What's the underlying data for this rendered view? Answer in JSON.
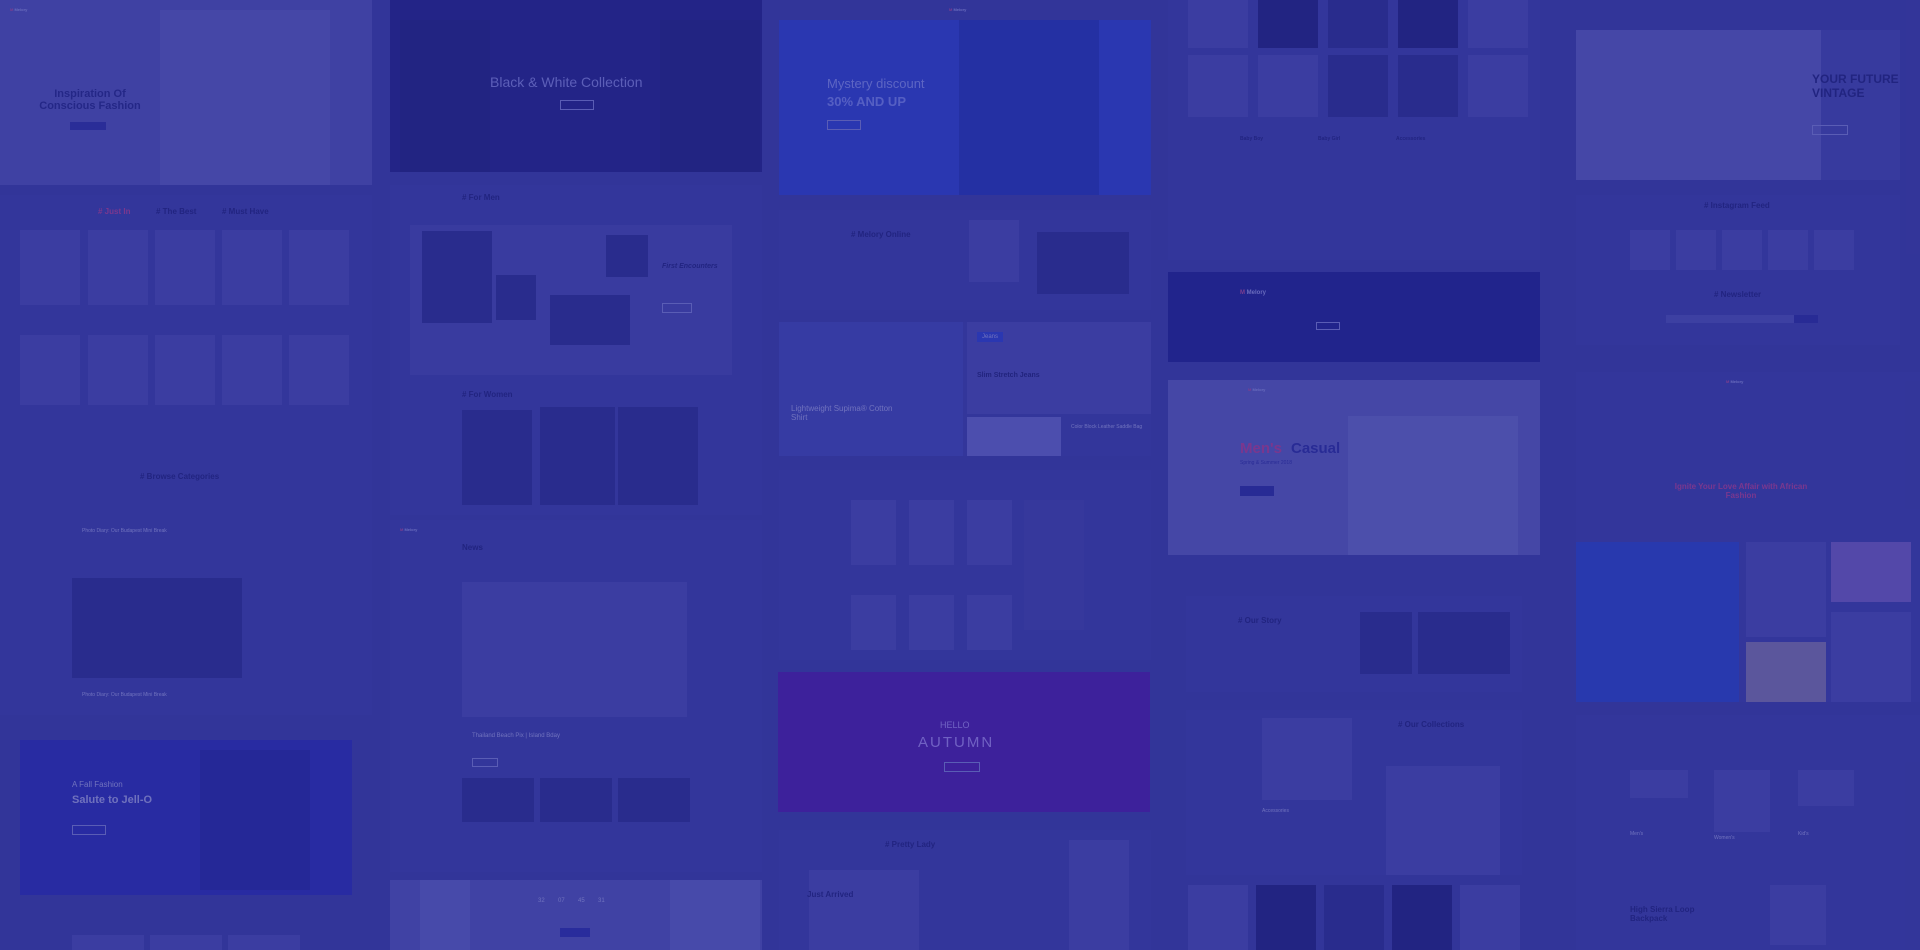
{
  "brand": {
    "name": "Melory",
    "accent": "#e04a8a",
    "overlay": "#2a2d95"
  },
  "tile1": {
    "hero_title": "Inspiration Of Conscious Fashion",
    "tabs": [
      "# Just In",
      "# The Best",
      "# Must Have"
    ],
    "section": "# Browse Categories",
    "post1": "Photo Diary: Our Budapest Mini Break",
    "post2": "Photo Diary: Our Budapest Mini Break"
  },
  "tile2": {
    "hero_title": "Black & White Collection",
    "men": "# For Men",
    "first": "First Encounters",
    "women": "# For Women",
    "news": "News",
    "news_post": "Thailand Beach Pix | Island Bday",
    "countdown": [
      "32",
      "07",
      "45",
      "31"
    ]
  },
  "tile3": {
    "hero_line1": "Mystery discount",
    "hero_line2": "30% AND UP",
    "online": "# Melory Online",
    "jeans_tag": "Jeans",
    "jeans": "Slim Stretch Jeans",
    "lightweight": "Lightweight Supima® Cotton Shirt",
    "saddle": "Color Block Leather Saddle Bag",
    "hello": "HELLO",
    "autumn": "AUTUMN",
    "pretty": "# Pretty Lady",
    "arrived": "Just Arrived"
  },
  "tile4": {
    "cols": [
      "Baby Boy",
      "Baby Girl",
      "Accessories"
    ],
    "mens_casual_a": "Men's",
    "mens_casual_b": "Casual",
    "season": "Spring & Summer 2018",
    "story": "# Our Story",
    "collections": "# Our Collections",
    "fashion_label": "Accessories"
  },
  "tile5": {
    "vintage": "YOUR FUTURE VINTAGE",
    "insta": "# Instagram Feed",
    "newsletter": "# Newsletter",
    "ignite": "Ignite Your Love Affair with African Fashion",
    "men": "Men's",
    "women": "Women's",
    "kids": "Kid's",
    "backpack": "High Sierra Loop Backpack"
  },
  "tile6": {
    "fall": "A Fall Fashion",
    "salute": "Salute to Jell-O"
  }
}
